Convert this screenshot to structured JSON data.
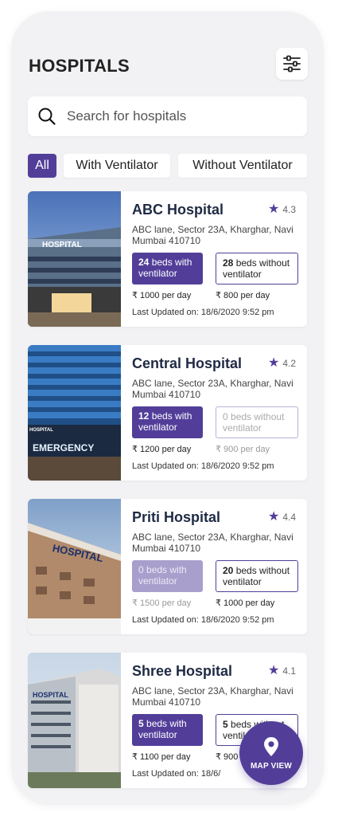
{
  "header": {
    "title": "HOSPITALS",
    "filter_icon": "sliders-icon"
  },
  "search": {
    "placeholder": "Search for hospitals",
    "icon": "search-icon"
  },
  "filters": [
    {
      "label": "All",
      "active": true
    },
    {
      "label": "With Ventilator",
      "active": false
    },
    {
      "label": "Without Ventilator",
      "active": false
    }
  ],
  "hospitals": [
    {
      "name": "ABC Hospital",
      "rating": "4.3",
      "address": "ABC lane, Sector 23A,  Kharghar, Navi Mumbai 410710",
      "with_vent_count": "24",
      "with_vent_text": " beds with ventilator",
      "without_vent_count": "28",
      "without_vent_text": " beds without ventilator",
      "with_vent_price": "₹ 1000 per day",
      "without_vent_price": "₹ 800 per day",
      "updated": "Last Updated on: 18/6/2020 9:52 pm",
      "image_text": "HOSPITAL"
    },
    {
      "name": "Central Hospital",
      "rating": "4.2",
      "address": "ABC lane, Sector 23A,  Kharghar, Navi Mumbai 410710",
      "with_vent_count": "12",
      "with_vent_text": " beds with ventilator",
      "without_vent_count": "0",
      "without_vent_text": " beds without ventilator",
      "with_vent_price": "₹ 1200 per day",
      "without_vent_price": "₹ 900 per day",
      "updated": "Last Updated on: 18/6/2020 9:52 pm",
      "image_text": "EMERGENCY",
      "image_text_2": "HOSPITAL"
    },
    {
      "name": "Priti Hospital",
      "rating": "4.4",
      "address": "ABC lane, Sector 23A,  Kharghar, Navi Mumbai 410710",
      "with_vent_count": "0",
      "with_vent_text": " beds with ventilator",
      "without_vent_count": "20",
      "without_vent_text": " beds without ventilator",
      "with_vent_price": "₹ 1500 per day",
      "without_vent_price": "₹ 1000 per day",
      "updated": "Last Updated on: 18/6/2020 9:52 pm",
      "image_text": "HOSPITAL"
    },
    {
      "name": "Shree Hospital",
      "rating": "4.1",
      "address": "ABC lane, Sector 23A,  Kharghar, Navi Mumbai 410710",
      "with_vent_count": "5",
      "with_vent_text": " beds with ventilator",
      "without_vent_count": "5",
      "without_vent_text": " beds without ventilator",
      "with_vent_price": "₹ 1100 per day",
      "without_vent_price": "₹ 900",
      "updated": "Last Updated on: 18/6/",
      "image_text": "HOSPITAL"
    }
  ],
  "fab": {
    "label": "MAP VIEW",
    "icon": "map-pin-icon"
  },
  "colors": {
    "accent": "#523e99",
    "background": "#f2f2f4",
    "card": "#ffffff"
  }
}
